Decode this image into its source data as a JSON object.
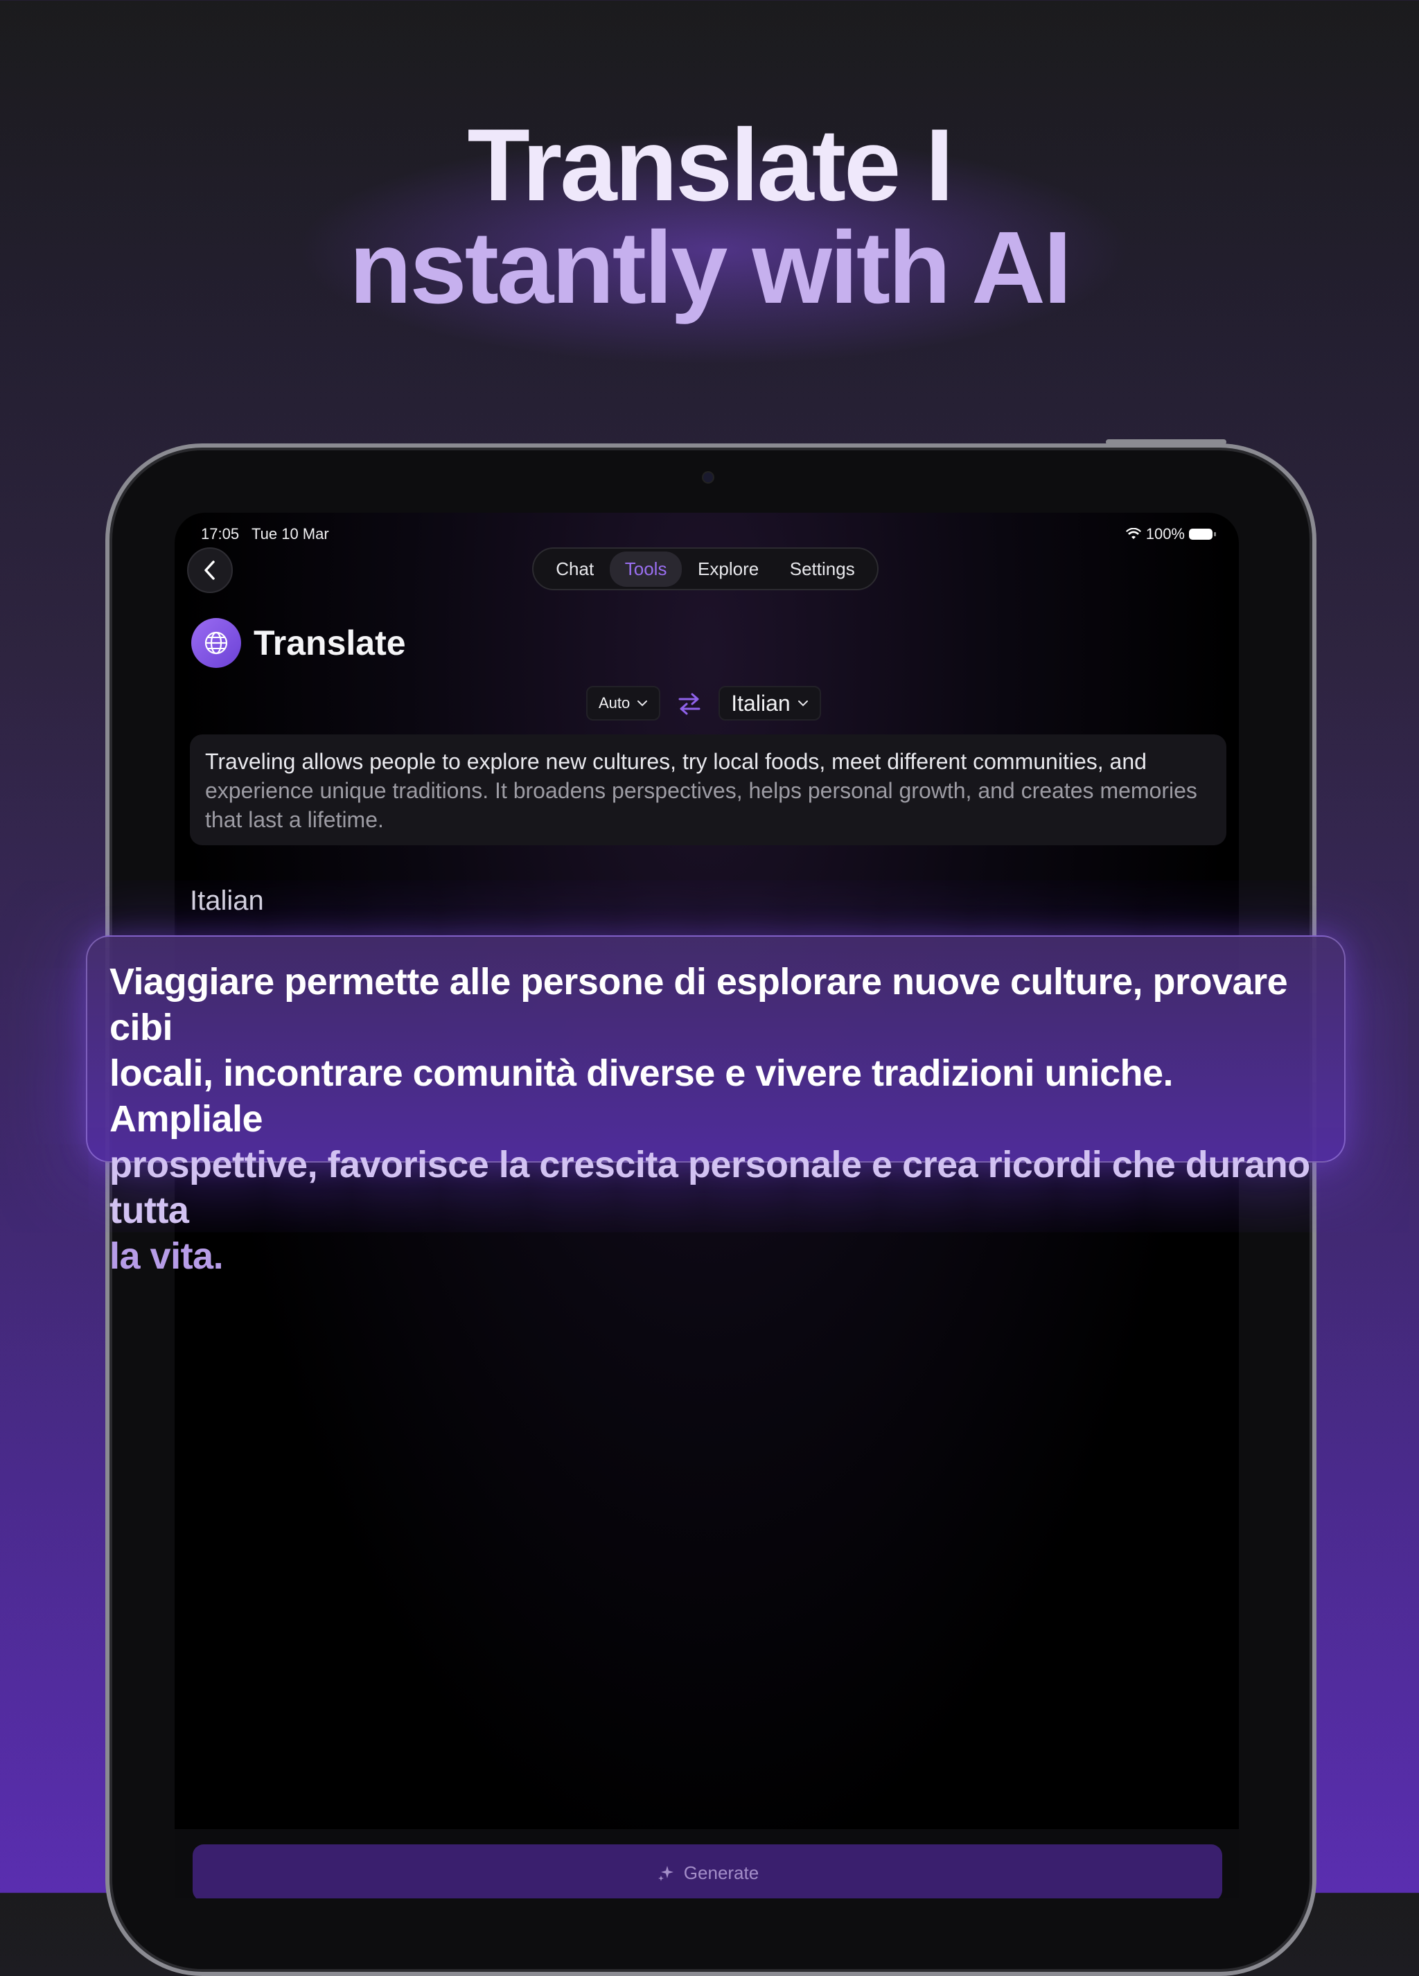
{
  "headline": {
    "line1": "Translate I",
    "line2": "nstantly with AI"
  },
  "status_bar": {
    "time": "17:05",
    "date": "Tue 10 Mar",
    "battery": "100%"
  },
  "nav": {
    "tabs": [
      {
        "label": "Chat",
        "active": false
      },
      {
        "label": "Tools",
        "active": true
      },
      {
        "label": "Explore",
        "active": false
      },
      {
        "label": "Settings",
        "active": false
      }
    ]
  },
  "page": {
    "title": "Translate",
    "icon": "globe-icon"
  },
  "languages": {
    "source": "Auto",
    "target": "Italian",
    "swap_icon": "swap-arrows-icon"
  },
  "input": {
    "text_a": "Traveling allows people to explore new cultures, try local foods, meet different communities, and",
    "text_b": "experience unique traditions. It broadens perspectives, helps personal growth, and creates memories",
    "text_c": "that last a lifetime."
  },
  "output": {
    "label": "Italian",
    "text_a": "Viaggiare permette alle persone di esplorare nuove culture, provare cibi",
    "text_b": "locali, incontrare comunità diverse e vivere tradizioni uniche. Ampliale",
    "text_c": "prospettive, favorisce la crescita personale e crea ricordi che durano tutta",
    "text_d": "la vita."
  },
  "actions": {
    "generate_label": "Generate"
  },
  "colors": {
    "accent": "#9a6ff0",
    "generate_bg": "#3a1f6e"
  }
}
